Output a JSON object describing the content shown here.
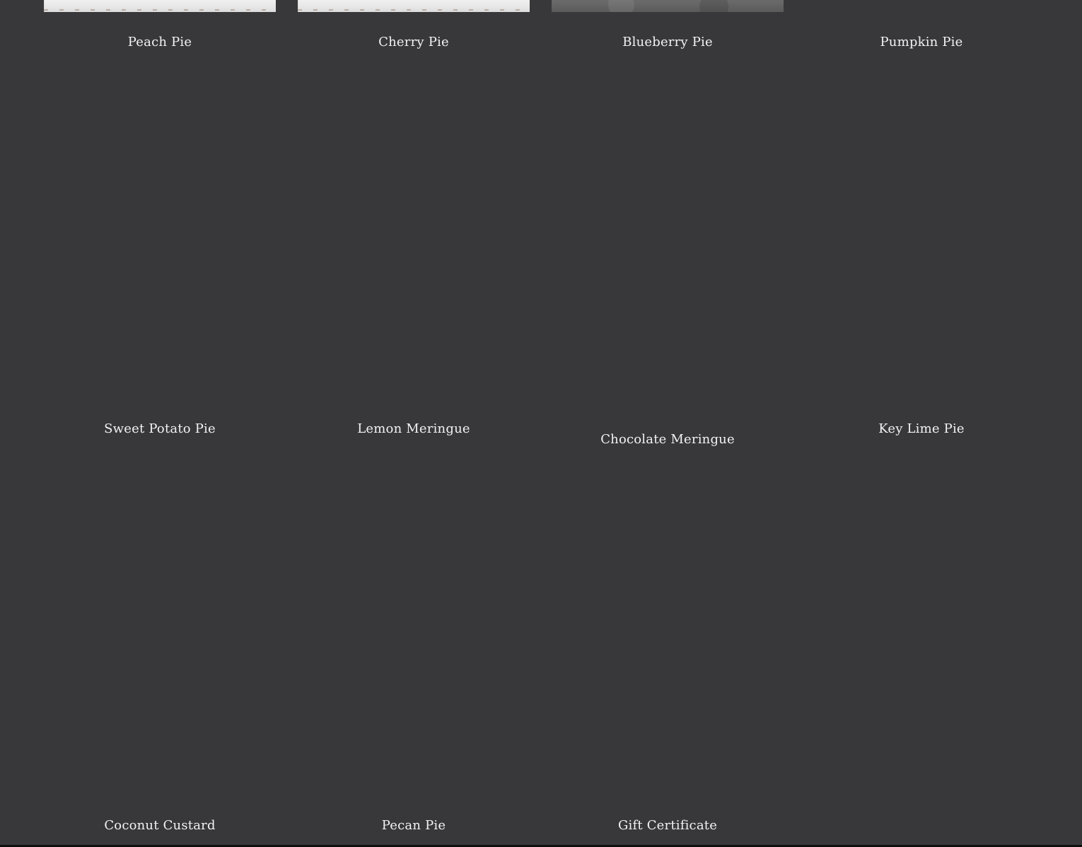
{
  "products": {
    "row1": [
      {
        "name": "Peach Pie",
        "thumb": "light"
      },
      {
        "name": "Cherry Pie",
        "thumb": "light"
      },
      {
        "name": "Blueberry Pie",
        "thumb": "dark"
      },
      {
        "name": "Pumpkin Pie"
      }
    ],
    "row2": [
      {
        "name": "Sweet Potato Pie"
      },
      {
        "name": "Lemon Meringue"
      },
      {
        "name": "Chocolate Meringue"
      },
      {
        "name": "Key Lime Pie"
      }
    ],
    "row3": [
      {
        "name": "Coconut Custard"
      },
      {
        "name": "Pecan Pie"
      },
      {
        "name": "Gift Certificate"
      }
    ]
  },
  "colors": {
    "background": "#38383a",
    "text": "#f2f2f2"
  }
}
